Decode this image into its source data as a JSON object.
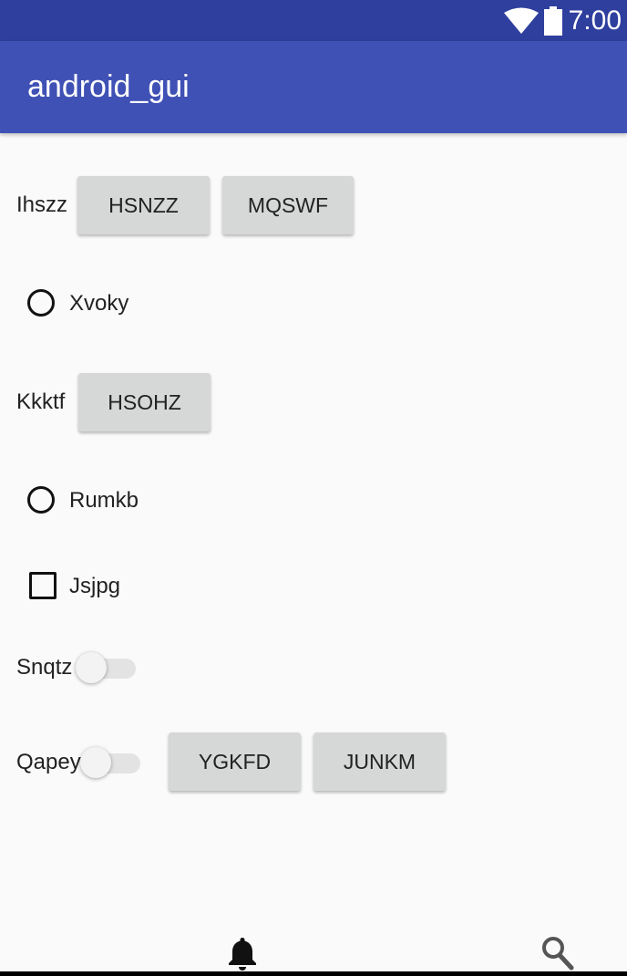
{
  "status_bar": {
    "time": "7:00",
    "icons": [
      "wifi-icon",
      "battery-icon"
    ],
    "background_color": "#2f3f9e"
  },
  "app_bar": {
    "title": "android_gui",
    "background_color": "#3f51b5"
  },
  "rows": {
    "row1": {
      "label": "Ihszz",
      "buttons": [
        "HSNZZ",
        "MQSWF"
      ]
    },
    "row2": {
      "radio_label": "Xvoky",
      "checked": false
    },
    "row3": {
      "label": "Kkktf",
      "buttons": [
        "HSOHZ"
      ]
    },
    "row4": {
      "radio_label": "Rumkb",
      "checked": false
    },
    "row5": {
      "checkbox_label": "Jsjpg",
      "checked": false
    },
    "row6": {
      "switch_label": "Snqtz",
      "on": false
    },
    "row7": {
      "switch_label": "Qapey",
      "on": false,
      "buttons": [
        "YGKFD",
        "JUNKM"
      ]
    }
  },
  "bottom_nav": {
    "icons": [
      "bell-icon",
      "search-icon"
    ]
  },
  "colors": {
    "button_bg": "#d6d7d7",
    "page_bg": "#fafafa"
  }
}
